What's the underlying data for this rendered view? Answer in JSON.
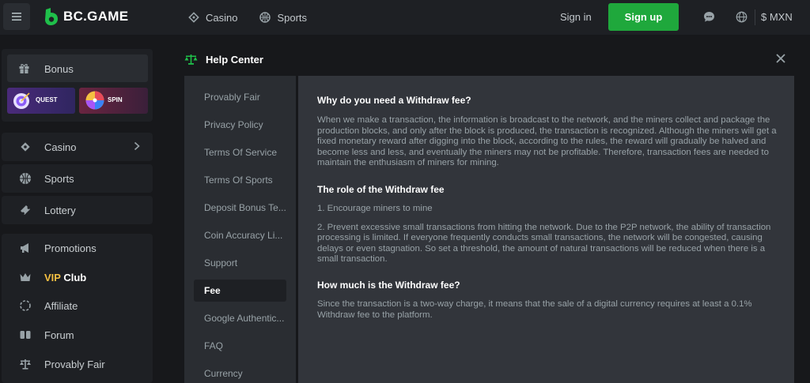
{
  "header": {
    "menu_icon": "hamburger-icon",
    "logo": "BC.GAME",
    "nav": [
      {
        "label": "Casino",
        "icon": "casino-icon"
      },
      {
        "label": "Sports",
        "icon": "basketball-icon"
      }
    ],
    "sign_in": "Sign in",
    "sign_up": "Sign up",
    "currency": "$ MXN"
  },
  "sidebar": {
    "bonus": "Bonus",
    "quest": "QUEST",
    "spin": "SPIN",
    "casino": "Casino",
    "sports": "Sports",
    "lottery": "Lottery",
    "promotions": "Promotions",
    "vip_prefix": "VIP",
    "vip_suffix": "Club",
    "affiliate": "Affiliate",
    "forum": "Forum",
    "provably_fair": "Provably Fair"
  },
  "help": {
    "title": "Help Center",
    "menu": [
      "Provably Fair",
      "Privacy Policy",
      "Terms Of Service",
      "Terms Of Sports",
      "Deposit Bonus Te...",
      "Coin Accuracy Li...",
      "Support",
      "Fee",
      "Google Authentic...",
      "FAQ",
      "Currency"
    ],
    "active_index": 7,
    "sections": {
      "h1": "Why do you need a Withdraw fee?",
      "p1": "When we make a transaction, the information is broadcast to the network, and the miners collect and package the production blocks, and only after the block is produced, the transaction is recognized. Although the miners will get a fixed monetary reward after digging into the block, according to the rules, the reward will gradually be halved and become less and less, and eventually the miners may not be profitable. Therefore, transaction fees are needed to maintain the enthusiasm of miners for mining.",
      "h2": "The role of the Withdraw fee",
      "p2": "1. Encourage miners to mine",
      "p3": "2. Prevent excessive small transactions from hitting the network. Due to the P2P network, the ability of transaction processing is limited. If everyone frequently conducts small transactions, the network will be congested, causing delays or even stagnation. So set a threshold, the amount of natural transactions will be reduced when there is a small transaction.",
      "h3": "How much is the Withdraw fee?",
      "p4": "Since the transaction is a two-way charge, it means that the sale of a digital currency requires at least a 0.1% Withdraw fee to the platform."
    }
  },
  "colors": {
    "accent": "#1fa83c",
    "vip": "#f5c042"
  }
}
